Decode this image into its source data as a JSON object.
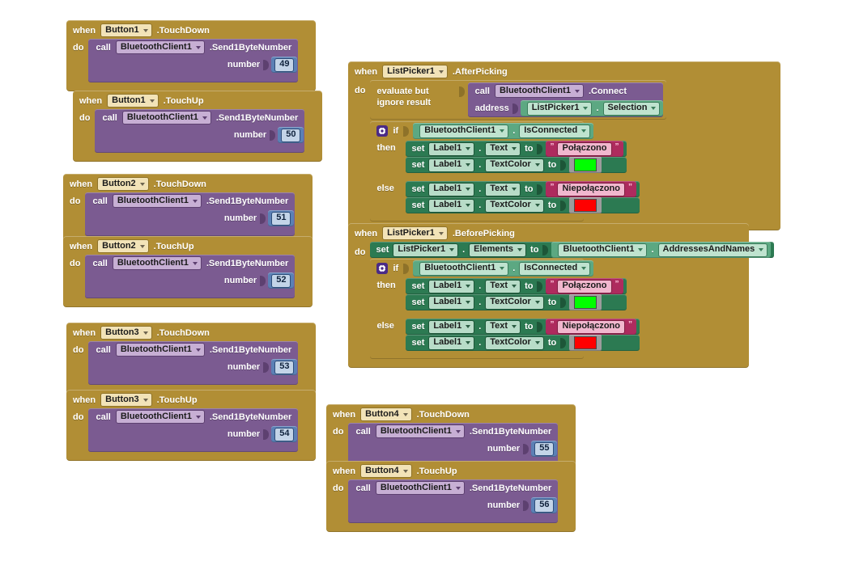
{
  "workspace": {
    "name": "MIT App Inventor Blocks Editor canvas",
    "background_color": "#ffffff"
  },
  "palette": {
    "event_gold": "#B18E35",
    "call_purple": "#7B5B91",
    "setter_green": "#2C7A52",
    "getter_green": "#5CA882",
    "text_magenta": "#AE2B5E",
    "number_blue": "#5B80B5",
    "color_block_grey": "#9C9C9C",
    "green_swatch": "#00FF00",
    "red_swatch": "#FF0000",
    "gear_purple": "#4A2A86"
  },
  "keywords": {
    "when": "when",
    "do": "do",
    "call": "call",
    "set": "set",
    "to": "to",
    "if": "if",
    "then": "then",
    "else": "else",
    "number_arg": "number",
    "address_arg": "address",
    "evaluate_but_ignore": "evaluate but ignore result",
    "dot": "."
  },
  "blocks": [
    {
      "id": "button1-touchdown",
      "kind": "event-call",
      "component": "Button1",
      "event": ".TouchDown",
      "call_component": "BluetoothClient1",
      "method": ".Send1ByteNumber",
      "arg_label": "number",
      "arg_value": "49"
    },
    {
      "id": "button1-touchup",
      "kind": "event-call",
      "component": "Button1",
      "event": ".TouchUp",
      "call_component": "BluetoothClient1",
      "method": ".Send1ByteNumber",
      "arg_label": "number",
      "arg_value": "50"
    },
    {
      "id": "button2-touchdown",
      "kind": "event-call",
      "component": "Button2",
      "event": ".TouchDown",
      "call_component": "BluetoothClient1",
      "method": ".Send1ByteNumber",
      "arg_label": "number",
      "arg_value": "51"
    },
    {
      "id": "button2-touchup",
      "kind": "event-call",
      "component": "Button2",
      "event": ".TouchUp",
      "call_component": "BluetoothClient1",
      "method": ".Send1ByteNumber",
      "arg_label": "number",
      "arg_value": "52"
    },
    {
      "id": "button3-touchdown",
      "kind": "event-call",
      "component": "Button3",
      "event": ".TouchDown",
      "call_component": "BluetoothClient1",
      "method": ".Send1ByteNumber",
      "arg_label": "number",
      "arg_value": "53"
    },
    {
      "id": "button3-touchup",
      "kind": "event-call",
      "component": "Button3",
      "event": ".TouchUp",
      "call_component": "BluetoothClient1",
      "method": ".Send1ByteNumber",
      "arg_label": "number",
      "arg_value": "54"
    },
    {
      "id": "button4-touchdown",
      "kind": "event-call",
      "component": "Button4",
      "event": ".TouchDown",
      "call_component": "BluetoothClient1",
      "method": ".Send1ByteNumber",
      "arg_label": "number",
      "arg_value": "55"
    },
    {
      "id": "button4-touchup",
      "kind": "event-call",
      "component": "Button4",
      "event": ".TouchUp",
      "call_component": "BluetoothClient1",
      "method": ".Send1ByteNumber",
      "arg_label": "number",
      "arg_value": "56"
    }
  ],
  "after_picking": {
    "component": "ListPicker1",
    "event": ".AfterPicking",
    "evaluate_label": "evaluate but ignore result",
    "call_component": "BluetoothClient1",
    "call_method": ".Connect",
    "address_label": "address",
    "address_object": "ListPicker1",
    "address_property": "Selection",
    "condition_object": "BluetoothClient1",
    "condition_property": "IsConnected",
    "then": {
      "set1_object": "Label1",
      "set1_property": "Text",
      "set1_value": "Połączono",
      "set2_object": "Label1",
      "set2_property": "TextColor",
      "set2_color": "#00FF00"
    },
    "else": {
      "set1_object": "Label1",
      "set1_property": "Text",
      "set1_value": "Niepołączono",
      "set2_object": "Label1",
      "set2_property": "TextColor",
      "set2_color": "#FF0000"
    }
  },
  "before_picking": {
    "component": "ListPicker1",
    "event": ".BeforePicking",
    "set_object": "ListPicker1",
    "set_property": "Elements",
    "value_object": "BluetoothClient1",
    "value_property": "AddressesAndNames",
    "condition_object": "BluetoothClient1",
    "condition_property": "IsConnected",
    "then": {
      "set1_object": "Label1",
      "set1_property": "Text",
      "set1_value": "Połączono",
      "set2_object": "Label1",
      "set2_property": "TextColor",
      "set2_color": "#00FF00"
    },
    "else": {
      "set1_object": "Label1",
      "set1_property": "Text",
      "set1_value": "Niepołączono",
      "set2_object": "Label1",
      "set2_property": "TextColor",
      "set2_color": "#FF0000"
    }
  }
}
